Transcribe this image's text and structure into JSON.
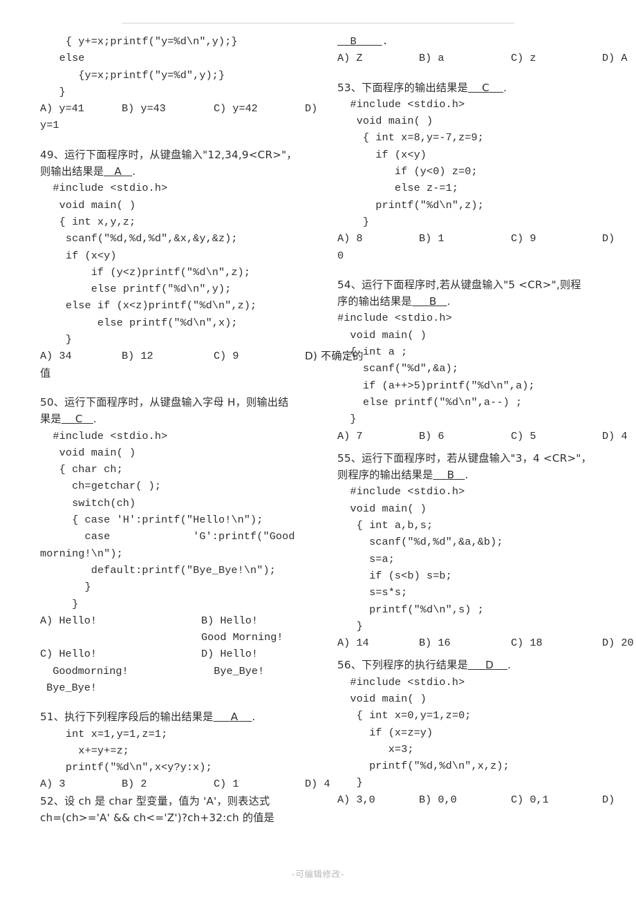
{
  "document": {
    "footer_note": "-可编辑修改-",
    "header_rule": true
  },
  "left_column": {
    "q48_tail": {
      "code_lines": [
        "    { y+=x;printf(\"y=%d\\n\",y);}",
        "   else",
        "      {y=x;printf(\"y=%d\",y);}",
        "   }"
      ],
      "options": [
        "A) y=41",
        "B) y=43",
        "C) y=42",
        "D)"
      ],
      "options_wrap": "y=1"
    },
    "q49": {
      "number": "49、",
      "prompt_line1": "运行下面程序时，从键盘输入\"12,34,9<CR>\"，",
      "prompt_line2_pre": "则输出结果是",
      "answer": "A",
      "prompt_line2_post": ".",
      "code_lines": [
        "  #include <stdio.h>",
        "   void main( )",
        "   { int x,y,z;",
        "    scanf(\"%d,%d,%d\",&x,&y,&z);",
        "    if (x<y)",
        "        if (y<z)printf(\"%d\\n\",z);",
        "        else printf(\"%d\\n\",y);",
        "    else if (x<z)printf(\"%d\\n\",z);",
        "         else printf(\"%d\\n\",x);",
        "    }"
      ],
      "options": [
        "A) 34",
        "B) 12",
        "C) 9",
        "D) 不确定的"
      ],
      "options_wrap": "值"
    },
    "q50": {
      "number": "50、",
      "prompt_line1": "运行下面程序时，从键盘输入字母 H，则输出结",
      "prompt_line2_pre": "果是",
      "answer": "C",
      "prompt_line2_post": ".",
      "code_lines": [
        "  #include <stdio.h>",
        "   void main( )",
        "   { char ch;",
        "     ch=getchar( );",
        "     switch(ch)",
        "     { case 'H':printf(\"Hello!\\n\");",
        "       case             'G':printf(\"Good",
        "morning!\\n\");",
        "        default:printf(\"Bye_Bye!\\n\");",
        "       }",
        "     }"
      ],
      "options_grid": [
        {
          "left": "A) Hello!",
          "right": "B) Hello!"
        },
        {
          "left": "",
          "right": "Good Morning!"
        },
        {
          "left": "C) Hello!",
          "right": "D) Hello!"
        },
        {
          "left": "  Goodmorning!",
          "right": "  Bye_Bye!"
        },
        {
          "left": " Bye_Bye!",
          "right": ""
        }
      ]
    },
    "q51": {
      "number": "51、",
      "prompt_pre": "执行下列程序段后的输出结果是",
      "answer": "A",
      "prompt_post": ".",
      "code_lines": [
        "    int x=1,y=1,z=1;",
        "      x+=y+=z;",
        "    printf(\"%d\\n\",x<y?y:x);"
      ],
      "options": [
        "A) 3",
        "B) 2",
        "C) 1",
        "D) 4"
      ]
    },
    "q52": {
      "number": "52、",
      "prompt_line1": "设 ch 是 char 型变量，值为 'A'，则表达式",
      "prompt_line2": "ch=(ch>='A' && ch<='Z')?ch+32:ch 的值是"
    }
  },
  "right_column": {
    "q52_tail": {
      "answer_line_pre": "",
      "answer": "B",
      "answer_line_post": ".",
      "options": [
        "A) Z",
        "B) a",
        "C) z",
        "D) A"
      ]
    },
    "q53": {
      "number": "53、",
      "prompt_pre": "下面程序的输出结果是",
      "answer": "C",
      "prompt_post": ".",
      "code_lines": [
        "  #include <stdio.h>",
        "   void main( )",
        "    { int x=8,y=-7,z=9;",
        "      if (x<y)",
        "         if (y<0) z=0;",
        "         else z-=1;",
        "      printf(\"%d\\n\",z);",
        "    }"
      ],
      "options": [
        "A) 8",
        "B) 1",
        "C) 9",
        "D)"
      ],
      "options_wrap": "0"
    },
    "q54": {
      "number": "54、",
      "prompt_line1": "运行下面程序时,若从键盘输入\"5 <CR>\",则程",
      "prompt_line2_pre": "序的输出结果是",
      "answer": "B",
      "prompt_line2_post": ".",
      "code_lines": [
        "#include <stdio.h>",
        "  void main( )",
        "  { int a ;",
        "    scanf(\"%d\",&a);",
        "    if (a++>5)printf(\"%d\\n\",a);",
        "    else printf(\"%d\\n\",a--) ;",
        "  }"
      ],
      "options": [
        "A) 7",
        "B) 6",
        "C) 5",
        "D) 4"
      ]
    },
    "q55": {
      "number": "55、",
      "prompt_line1": "运行下面程序时，若从键盘输入\"3，4 <CR>\"，",
      "prompt_line2_pre": "则程序的输出结果是",
      "answer": "B",
      "prompt_line2_post": ".",
      "code_lines": [
        "  #include <stdio.h>",
        "  void main( )",
        "   { int a,b,s;",
        "     scanf(\"%d,%d\",&a,&b);",
        "     s=a;",
        "     if (s<b) s=b;",
        "     s=s*s;",
        "     printf(\"%d\\n\",s) ;",
        "   }"
      ],
      "options": [
        "A) 14",
        "B) 16",
        "C) 18",
        "D) 20"
      ]
    },
    "q56": {
      "number": "56、",
      "prompt_pre": "下列程序的执行结果是",
      "answer": "D",
      "prompt_post": ".",
      "code_lines": [
        "  #include <stdio.h>",
        "  void main( )",
        "   { int x=0,y=1,z=0;",
        "     if (x=z=y)",
        "        x=3;",
        "     printf(\"%d,%d\\n\",x,z);",
        "   }"
      ],
      "options": [
        "A) 3,0",
        "B) 0,0",
        "C) 0,1",
        "D)"
      ]
    }
  }
}
